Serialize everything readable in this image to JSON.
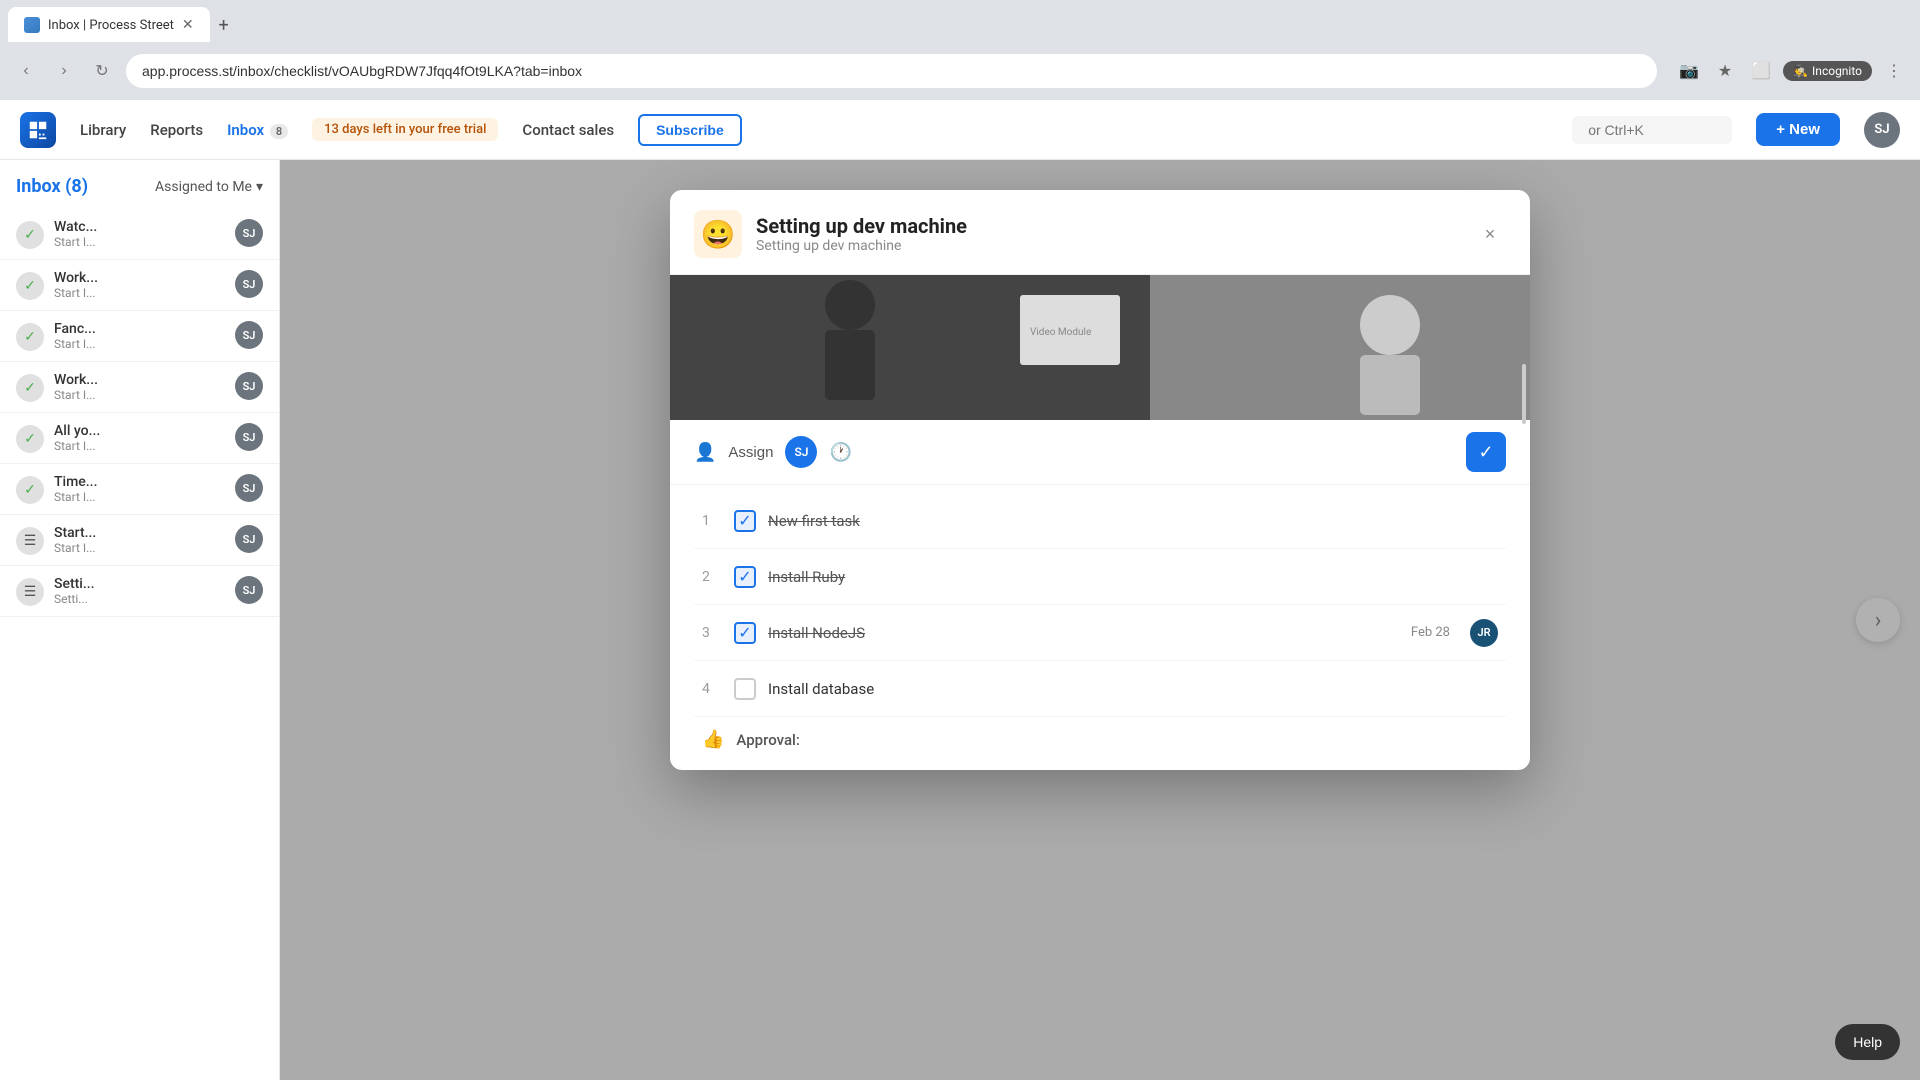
{
  "browser": {
    "tab_title": "Inbox | Process Street",
    "url": "app.process.st/inbox/checklist/vOAUbgRDW7Jfqq4fOt9LKA?tab=inbox",
    "new_tab_label": "+"
  },
  "topnav": {
    "library_label": "Library",
    "reports_label": "Reports",
    "inbox_label": "Inbox",
    "inbox_count": "8",
    "trial_text": "13 days left in your free trial",
    "contact_sales_label": "Contact sales",
    "subscribe_label": "Subscribe",
    "search_placeholder": "or Ctrl+K",
    "new_button_label": "+ New",
    "avatar_initials": "SJ"
  },
  "sidebar": {
    "title": "Inbox (8)",
    "filter_label": "Assigned to Me",
    "items": [
      {
        "title": "Watc...",
        "sub": "Start I...",
        "type": "check",
        "avatar": "SJ"
      },
      {
        "title": "Work...",
        "sub": "Start I...",
        "type": "check",
        "avatar": "SJ"
      },
      {
        "title": "Fanc...",
        "sub": "Start I...",
        "type": "check",
        "avatar": "SJ"
      },
      {
        "title": "Work...",
        "sub": "Start I...",
        "type": "check",
        "avatar": "SJ"
      },
      {
        "title": "All yo...",
        "sub": "Start I...",
        "type": "check",
        "avatar": "SJ"
      },
      {
        "title": "Time...",
        "sub": "Start I...",
        "type": "check",
        "avatar": "SJ"
      },
      {
        "title": "Start...",
        "sub": "Start I...",
        "type": "list",
        "avatar": "SJ"
      },
      {
        "title": "Setti...",
        "sub": "Setti...",
        "type": "list",
        "avatar": "SJ"
      }
    ]
  },
  "modal": {
    "emoji": "😀",
    "title": "Setting up dev machine",
    "subtitle": "Setting up dev machine",
    "close_label": "×",
    "assign_label": "Assign",
    "assign_avatar": "SJ",
    "complete_icon": "✓",
    "tasks": [
      {
        "num": "1",
        "label": "New first task",
        "checked": true,
        "strikethrough": true,
        "date": "",
        "avatar": ""
      },
      {
        "num": "2",
        "label": "Install Ruby",
        "checked": true,
        "strikethrough": true,
        "date": "",
        "avatar": ""
      },
      {
        "num": "3",
        "label": "Install NodeJS",
        "checked": true,
        "strikethrough": true,
        "date": "Feb 28",
        "avatar": "JR"
      },
      {
        "num": "4",
        "label": "Install database",
        "checked": false,
        "strikethrough": false,
        "date": "",
        "avatar": ""
      }
    ],
    "approval_label": "Approval:"
  },
  "help_label": "Help",
  "right_arrow": "›"
}
